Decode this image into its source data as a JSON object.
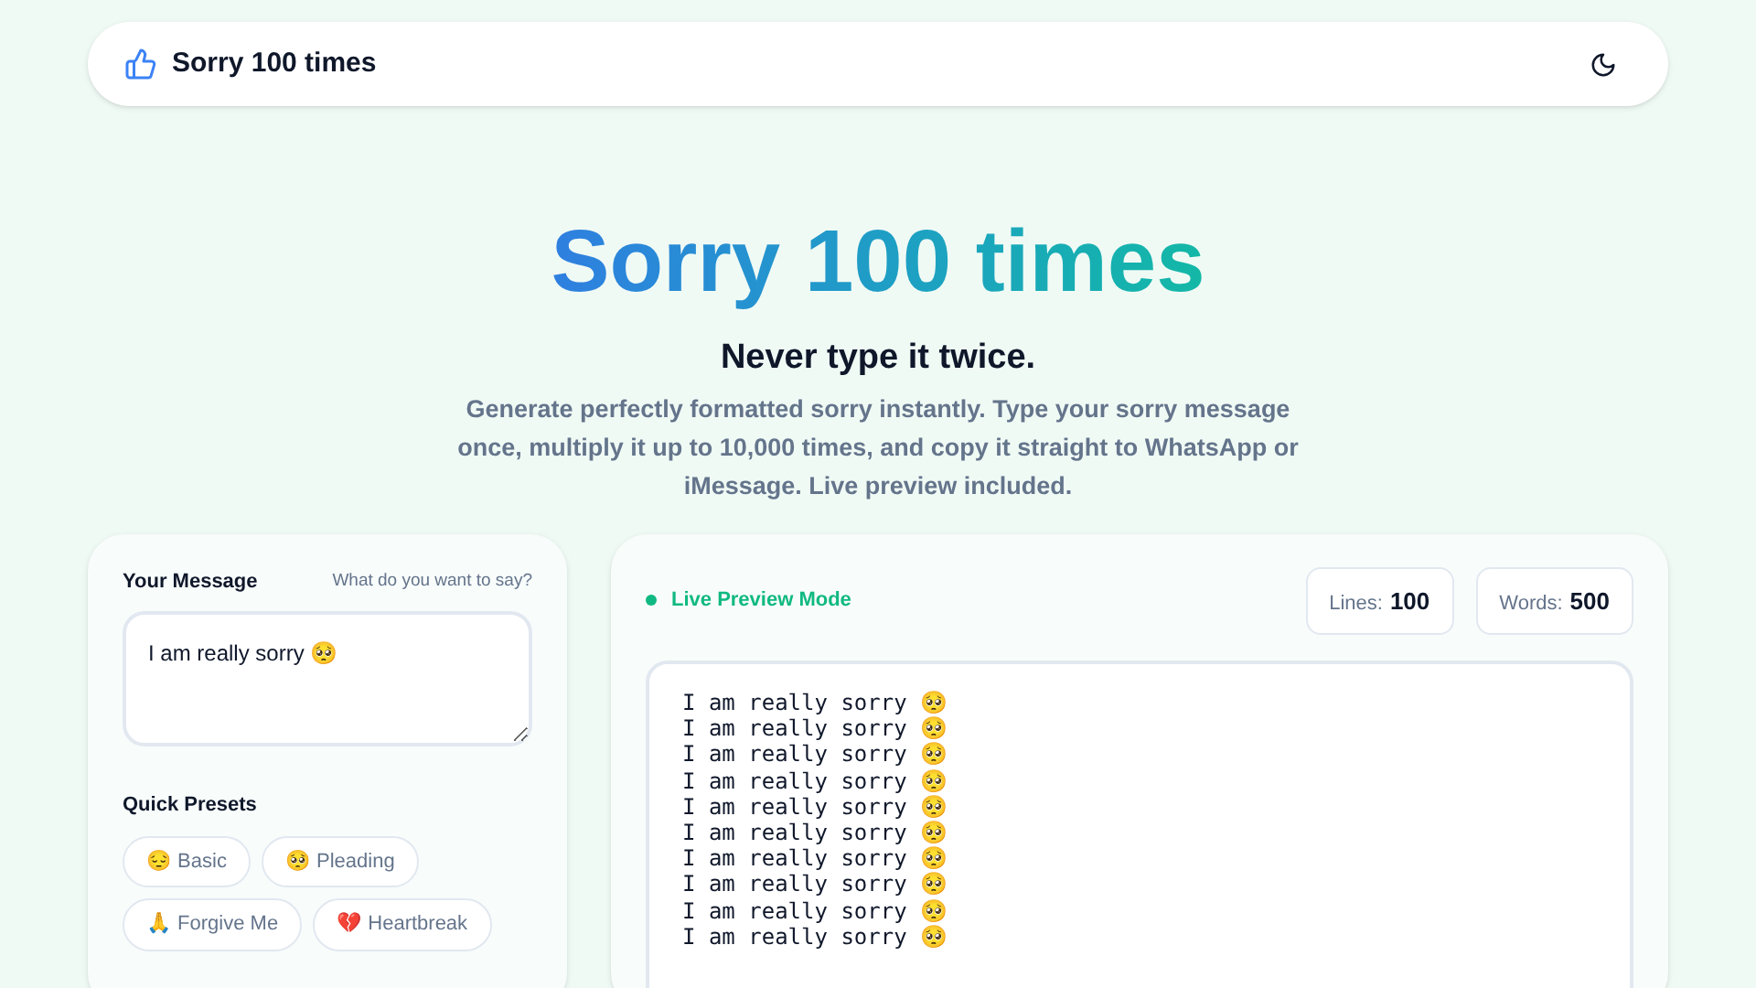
{
  "header": {
    "brand": "Sorry 100 times"
  },
  "hero": {
    "title": "Sorry 100 times",
    "subtitle": "Never type it twice.",
    "description": "Generate perfectly formatted sorry instantly. Type your sorry message once, multiply it up to 10,000 times, and copy it straight to WhatsApp or iMessage. Live preview included."
  },
  "message_panel": {
    "label": "Your Message",
    "hint": "What do you want to say?",
    "value": "I am really sorry 🥺",
    "presets_label": "Quick Presets",
    "presets": [
      "😔 Basic",
      "🥺 Pleading",
      "🙏 Forgive Me",
      "💔 Heartbreak"
    ]
  },
  "preview_panel": {
    "mode": "Live Preview Mode",
    "stats": [
      {
        "label": "Lines:",
        "value": "100"
      },
      {
        "label": "Words:",
        "value": "500"
      }
    ],
    "lines": [
      "I am really sorry 🥺",
      "I am really sorry 🥺",
      "I am really sorry 🥺",
      "I am really sorry 🥺",
      "I am really sorry 🥺",
      "I am really sorry 🥺",
      "I am really sorry 🥺",
      "I am really sorry 🥺",
      "I am really sorry 🥺",
      "I am really sorry 🥺"
    ]
  }
}
